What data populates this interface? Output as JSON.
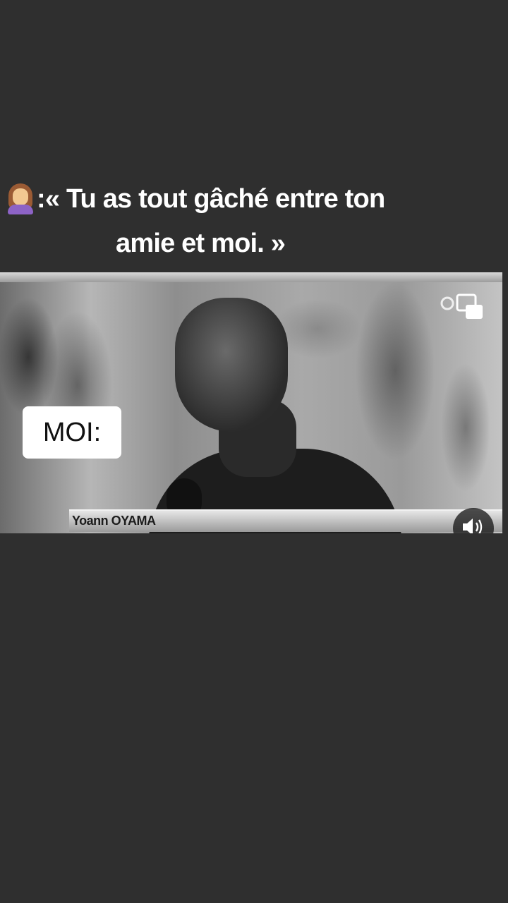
{
  "caption": {
    "emoji": "woman-emoji",
    "line1": ":« Tu as tout gâché entre ton",
    "line2": "amie et moi. »"
  },
  "video": {
    "overlay_label": "MOI:",
    "nameplate": "Yoann OYAMA",
    "sound_icon": "speaker-icon",
    "watermark_icon": "pip-icon"
  },
  "colors": {
    "background": "#2f2f2f",
    "caption_text": "#ffffff",
    "label_box": "#ffffff"
  }
}
